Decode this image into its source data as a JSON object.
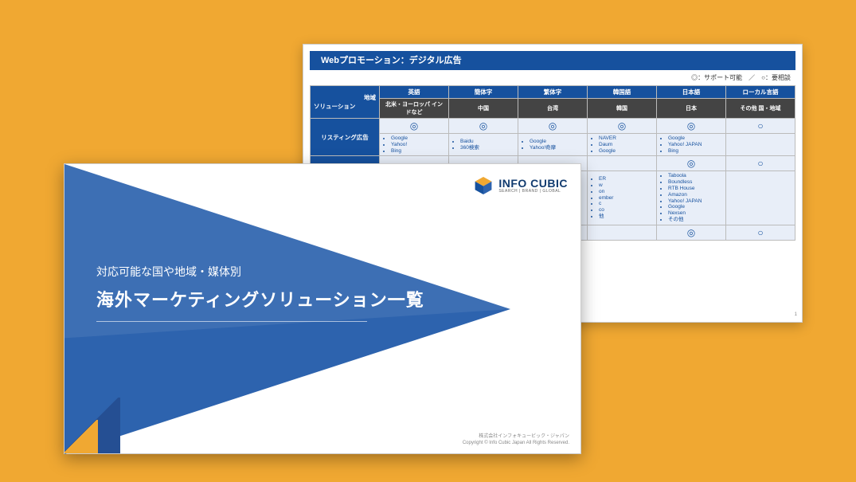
{
  "back": {
    "title": "Webプロモーション：デジタル広告",
    "legend": "◎：サポート可能　／　○：要相談",
    "corner": {
      "top": "地域",
      "bottom": "ソリューション"
    },
    "lang_headers": [
      "英語",
      "簡体字",
      "繁体字",
      "韓国語",
      "日本語",
      "ローカル言語"
    ],
    "region_headers": [
      "北米・ヨーロッパ\nインドなど",
      "中国",
      "台湾",
      "韓国",
      "日本",
      "その他\n国・地域"
    ],
    "row1": {
      "name": "リスティング広告",
      "marks": [
        "◎",
        "◎",
        "◎",
        "◎",
        "◎",
        "○"
      ],
      "lists": [
        [
          "Google",
          "Yahoo!",
          "Bing"
        ],
        [
          "Baidu",
          "360検索"
        ],
        [
          "Google",
          "Yahoo!奇摩"
        ],
        [
          "NAVER",
          "Daum",
          "Google"
        ],
        [
          "Google",
          "Yahoo! JAPAN",
          "Bing"
        ],
        []
      ]
    },
    "row2": {
      "name": "",
      "marks": [
        "",
        "",
        "",
        "",
        "◎",
        "○"
      ],
      "lists": [
        [],
        [],
        [],
        [
          "ER",
          "w",
          "on",
          "ember",
          "c",
          "co",
          "他"
        ],
        [
          "Taboola",
          "Boundless",
          "RTB House",
          "Amazon",
          "Yahoo! JAPAN",
          "Google",
          "Nexsen",
          "その他"
        ],
        []
      ]
    },
    "row3": {
      "marks": [
        "",
        "",
        "",
        "",
        "◎",
        "○"
      ]
    },
    "page": "1"
  },
  "front": {
    "subtitle": "対応可能な国や地域・媒体別",
    "title": "海外マーケティングソリューション一覧",
    "logo_name": "INFO CUBIC",
    "logo_tag": "SEARCH | BRAND | GLOBAL",
    "copyright_line1": "株式会社インフォキュービック・ジャパン",
    "copyright_line2": "Copyright © Info Cubic Japan All Rights Reserved."
  }
}
